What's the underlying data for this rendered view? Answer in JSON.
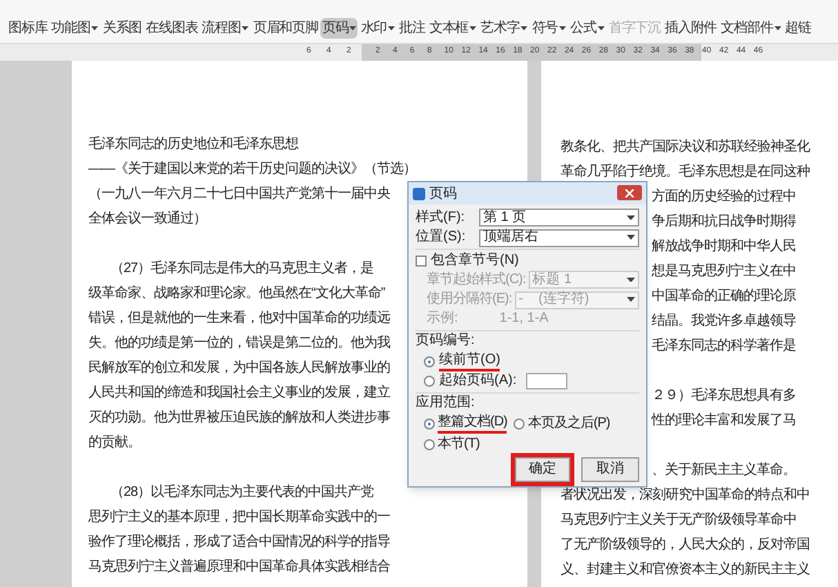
{
  "ribbon": {
    "items": [
      {
        "label": "图标库",
        "dropdown": false,
        "selected": false,
        "disabled": false
      },
      {
        "label": "功能图",
        "dropdown": true,
        "selected": false,
        "disabled": false
      },
      {
        "label": "关系图",
        "dropdown": false,
        "selected": false,
        "disabled": false
      },
      {
        "label": "在线图表",
        "dropdown": false,
        "selected": false,
        "disabled": false
      },
      {
        "label": "流程图",
        "dropdown": true,
        "selected": false,
        "disabled": false
      },
      {
        "label": "页眉和页脚",
        "dropdown": false,
        "selected": false,
        "disabled": false
      },
      {
        "label": "页码",
        "dropdown": true,
        "selected": true,
        "disabled": false
      },
      {
        "label": "水印",
        "dropdown": true,
        "selected": false,
        "disabled": false
      },
      {
        "label": "批注",
        "dropdown": false,
        "selected": false,
        "disabled": false
      },
      {
        "label": "文本框",
        "dropdown": true,
        "selected": false,
        "disabled": false
      },
      {
        "label": "艺术字",
        "dropdown": true,
        "selected": false,
        "disabled": false
      },
      {
        "label": "符号",
        "dropdown": true,
        "selected": false,
        "disabled": false
      },
      {
        "label": "公式",
        "dropdown": true,
        "selected": false,
        "disabled": false
      },
      {
        "label": "首字下沉",
        "dropdown": false,
        "selected": false,
        "disabled": true
      },
      {
        "label": "插入附件",
        "dropdown": false,
        "selected": false,
        "disabled": false
      },
      {
        "label": "文档部件",
        "dropdown": true,
        "selected": false,
        "disabled": false
      },
      {
        "label": "超链",
        "dropdown": false,
        "selected": false,
        "disabled": false
      }
    ]
  },
  "ruler": {
    "ticks": [
      "6",
      "4",
      "2",
      "2",
      "4",
      "6",
      "8",
      "10",
      "12",
      "14",
      "16",
      "18",
      "20",
      "22",
      "24",
      "26",
      "28",
      "30",
      "32",
      "34",
      "36",
      "38",
      "40",
      "42",
      "44",
      "46"
    ]
  },
  "left_page": {
    "paragraphs": [
      {
        "kind": "heading",
        "lines": [
          "毛泽东同志的历史地位和毛泽东思想",
          "——《关于建国以来党的若干历史问题的决议》（节选）",
          "（一九八一年六月二十七日中国共产党第十一届中央",
          "全体会议一致通过）"
        ]
      },
      {
        "kind": "body",
        "lines": [
          "（27）毛泽东同志是伟大的马克思主义者，是",
          "级革命家、战略家和理论家。他虽然在“文化大革命”",
          "错误，但是就他的一生来看，他对中国革命的功绩远",
          "失。他的功绩是第一位的，错误是第二位的。他为我",
          "民解放军的创立和发展，为中国各族人民解放事业的",
          "人民共和国的缔造和我国社会主义事业的发展，建立",
          "灭的功勋。他为世界被压迫民族的解放和人类进步事",
          "的贡献。"
        ]
      },
      {
        "kind": "body",
        "lines": [
          "（28）以毛泽东同志为主要代表的中国共产党",
          "思列宁主义的基本原理，把中国长期革命实践中的一",
          "验作了理论概括，形成了适合中国情况的科学的指导",
          "马克思列宁主义普遍原理和中国革命具体实践相结合"
        ]
      }
    ]
  },
  "right_page": {
    "paragraphs": [
      {
        "lines": [
          "教条化、把共产国际决议和苏联经验神圣化",
          "革命几乎陷于绝境。毛泽东思想是在同这种",
          "方面的历史经验的过程中",
          "争后期和抗日战争时期得",
          "解放战争时期和中华人民",
          "想是马克思列宁主义在中",
          "中国革命的正确的理论原",
          "结晶。我党许多卓越领导",
          "毛泽东同志的科学著作是"
        ]
      },
      {
        "lines": [
          "２９）毛泽东思想具有多",
          "性的理论丰富和发展了马"
        ]
      },
      {
        "lines": [
          "、关于新民主主义革命。",
          "者状况出发，深刻研究中国革命的特点和中",
          "马克思列宁主义关于无产阶级领导革命中",
          "了无产阶级领导的，人民大众的，反对帝国",
          "义、封建主义和官僚资本主义的新民主主义"
        ]
      }
    ]
  },
  "dialog": {
    "title": "页码",
    "style_label": "样式(F):",
    "style_value": "第 1 页",
    "position_label": "位置(S):",
    "position_value": "顶端居右",
    "include_chapter": {
      "label": "包含章节号(N)",
      "checked": false
    },
    "chapter_style_label": "章节起始样式(C):",
    "chapter_style_value": "标题 1",
    "separator_label": "使用分隔符(E):",
    "separator_value": "-    (连字符)",
    "example_label": "示例:",
    "example_value": "1-1, 1-A",
    "numbering_label": "页码编号:",
    "numbering_options": [
      {
        "label": "续前节(O)",
        "selected": true,
        "kind": "radio"
      },
      {
        "label": "起始页码(A):",
        "selected": false,
        "kind": "spin"
      }
    ],
    "scope_label": "应用范围:",
    "scope_options": [
      {
        "label": "整篇文档(D)",
        "selected": true
      },
      {
        "label": "本页及之后(P)",
        "selected": false
      },
      {
        "label": "本节(T)",
        "selected": false
      }
    ],
    "ok": "确定",
    "cancel": "取消"
  }
}
